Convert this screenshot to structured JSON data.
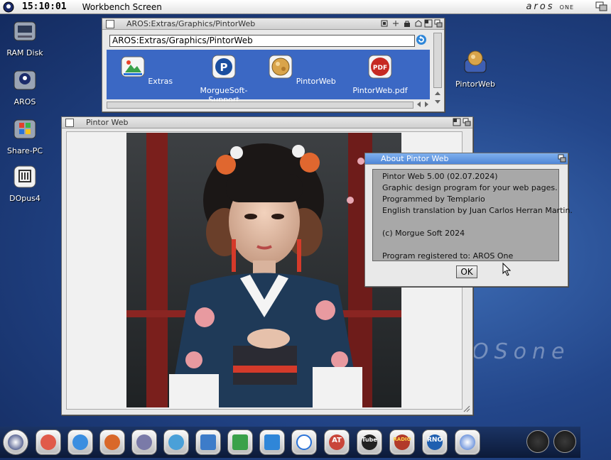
{
  "screen": {
    "clock": "15:10:01",
    "title": "Workbench Screen",
    "brand": "aros",
    "brand_suffix": "ONE"
  },
  "desktop_icons": [
    {
      "label": "RAM Disk",
      "icon": "ram-disk-icon"
    },
    {
      "label": "AROS",
      "icon": "aros-drive-icon"
    },
    {
      "label": "Share-PC",
      "icon": "windows-share-icon"
    },
    {
      "label": "DOpus4",
      "icon": "dopus-icon"
    },
    {
      "label": "PintorWeb",
      "icon": "pintorweb-drive-icon"
    }
  ],
  "drawer_window": {
    "title": "AROS:Extras/Graphics/PintorWeb",
    "path": "AROS:Extras/Graphics/PintorWeb",
    "files": [
      {
        "label": "Extras",
        "icon": "extras-drawer-icon"
      },
      {
        "label": "MorgueSoft-Support",
        "icon": "paypal-icon"
      },
      {
        "label": "PintorWeb",
        "icon": "pintorweb-app-icon"
      },
      {
        "label": "PintorWeb.pdf",
        "icon": "pdf-icon"
      }
    ]
  },
  "image_window": {
    "title": "Pintor Web",
    "image": "portrait-woman-kimono"
  },
  "about_window": {
    "title": "About Pintor Web",
    "lines": [
      "Pintor Web 5.00 (02.07.2024)",
      "Graphic design program for your web pages.",
      "Programmed by Templario",
      "English translation by Juan Carlos Herran Martin.",
      "",
      "(c) Morgue Soft 2024",
      "",
      "Program registered to: AROS One"
    ],
    "ok_label": "OK"
  },
  "wallpaper_text": "OSone",
  "taskbar": {
    "items": [
      {
        "name": "aros-menu-icon"
      },
      {
        "name": "paint-icon"
      },
      {
        "name": "search-icon"
      },
      {
        "name": "browser-icon"
      },
      {
        "name": "mascot-icon"
      },
      {
        "name": "editor-icon"
      },
      {
        "name": "monitor-icon"
      },
      {
        "name": "display-icon"
      },
      {
        "name": "screen-icon"
      },
      {
        "name": "scissors-icon"
      },
      {
        "name": "chart-icon",
        "label": "AT"
      },
      {
        "name": "tube-icon",
        "label": "Tube"
      },
      {
        "name": "radio-icon",
        "label": "RADIO"
      },
      {
        "name": "rno-tunes-icon",
        "label": "RNO"
      },
      {
        "name": "compass-icon"
      }
    ]
  },
  "colors": {
    "accent": "#3b68c4",
    "desktop": "#23468a"
  }
}
